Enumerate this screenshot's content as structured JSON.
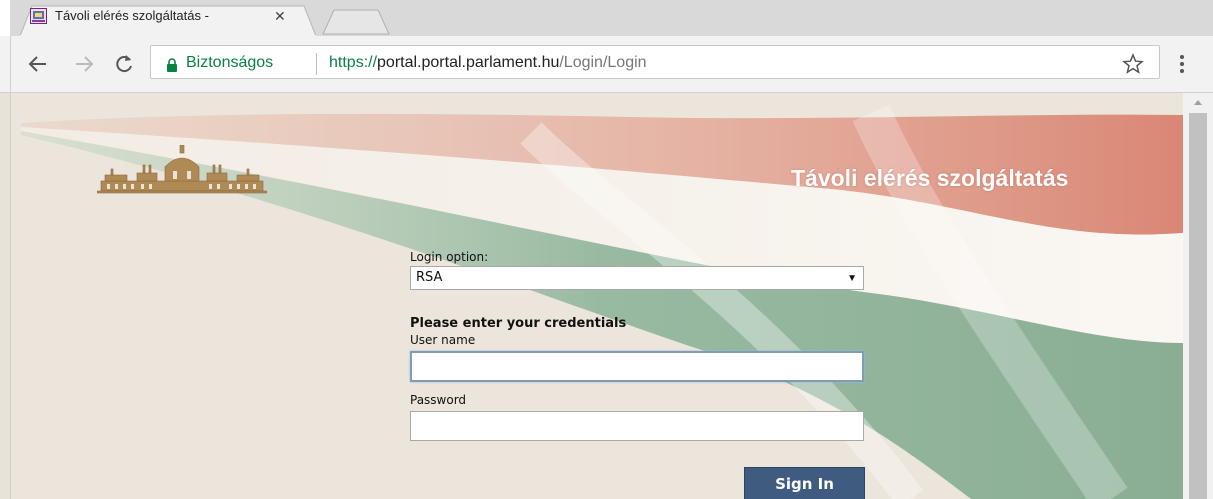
{
  "browser": {
    "tab_title": "Távoli elérés szolgáltatás -",
    "secure_label": "Biztonságos",
    "url": {
      "scheme": "https://",
      "host": "portal.portal.parlament.hu",
      "path": "/Login/Login"
    },
    "colors": {
      "secure_green": "#0b8043",
      "toolbar_bg": "#f2f2f2",
      "tabstrip_bg": "#d9d9d9"
    },
    "icons": [
      "back-arrow-icon",
      "forward-arrow-icon",
      "reload-icon",
      "lock-icon",
      "star-icon",
      "menu-icon",
      "tab-close-icon",
      "favicon-icon"
    ]
  },
  "page": {
    "title": "Távoli elérés szolgáltatás",
    "login_option_label": "Login option:",
    "login_option_value": "RSA",
    "credentials_heading": "Please enter your credentials",
    "username_label": "User name",
    "password_label": "Password",
    "signin_label": "Sign In",
    "colors": {
      "page_bg": "#ece5db",
      "flag_red": "#d98a7b",
      "flag_green": "#8fb59b",
      "button_bg": "#3f5b80"
    }
  }
}
